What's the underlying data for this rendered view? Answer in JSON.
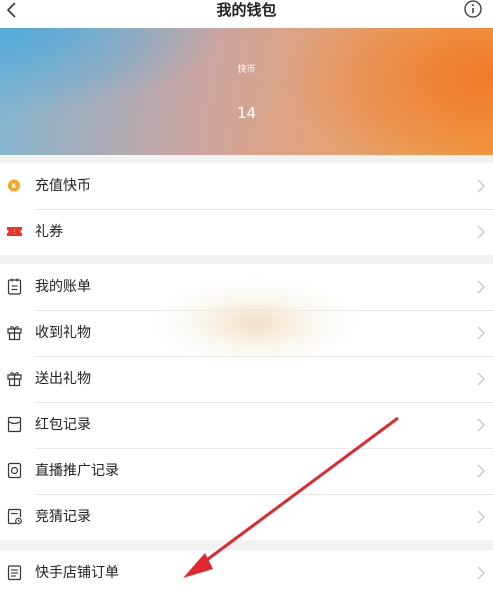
{
  "header": {
    "title": "我的钱包"
  },
  "balance": {
    "label": "快币",
    "value": "14"
  },
  "groups": [
    {
      "items": [
        {
          "label": "充值快币",
          "icon": "coin-icon",
          "color": "#f5a623"
        },
        {
          "label": "礼券",
          "icon": "coupon-icon",
          "color": "#e8332d"
        }
      ]
    },
    {
      "items": [
        {
          "label": "我的账单",
          "icon": "bill-icon"
        },
        {
          "label": "收到礼物",
          "icon": "gift-icon"
        },
        {
          "label": "送出礼物",
          "icon": "gift-icon"
        },
        {
          "label": "红包记录",
          "icon": "red-envelope-icon"
        },
        {
          "label": "直播推广记录",
          "icon": "live-promotion-icon"
        },
        {
          "label": "竞猜记录",
          "icon": "quiz-record-icon"
        }
      ]
    },
    {
      "items": [
        {
          "label": "快手店铺订单",
          "icon": "order-icon"
        }
      ]
    }
  ],
  "colors": {
    "arrow": "#e0282e",
    "text": "#222222",
    "chevron": "#c4c4c4"
  }
}
